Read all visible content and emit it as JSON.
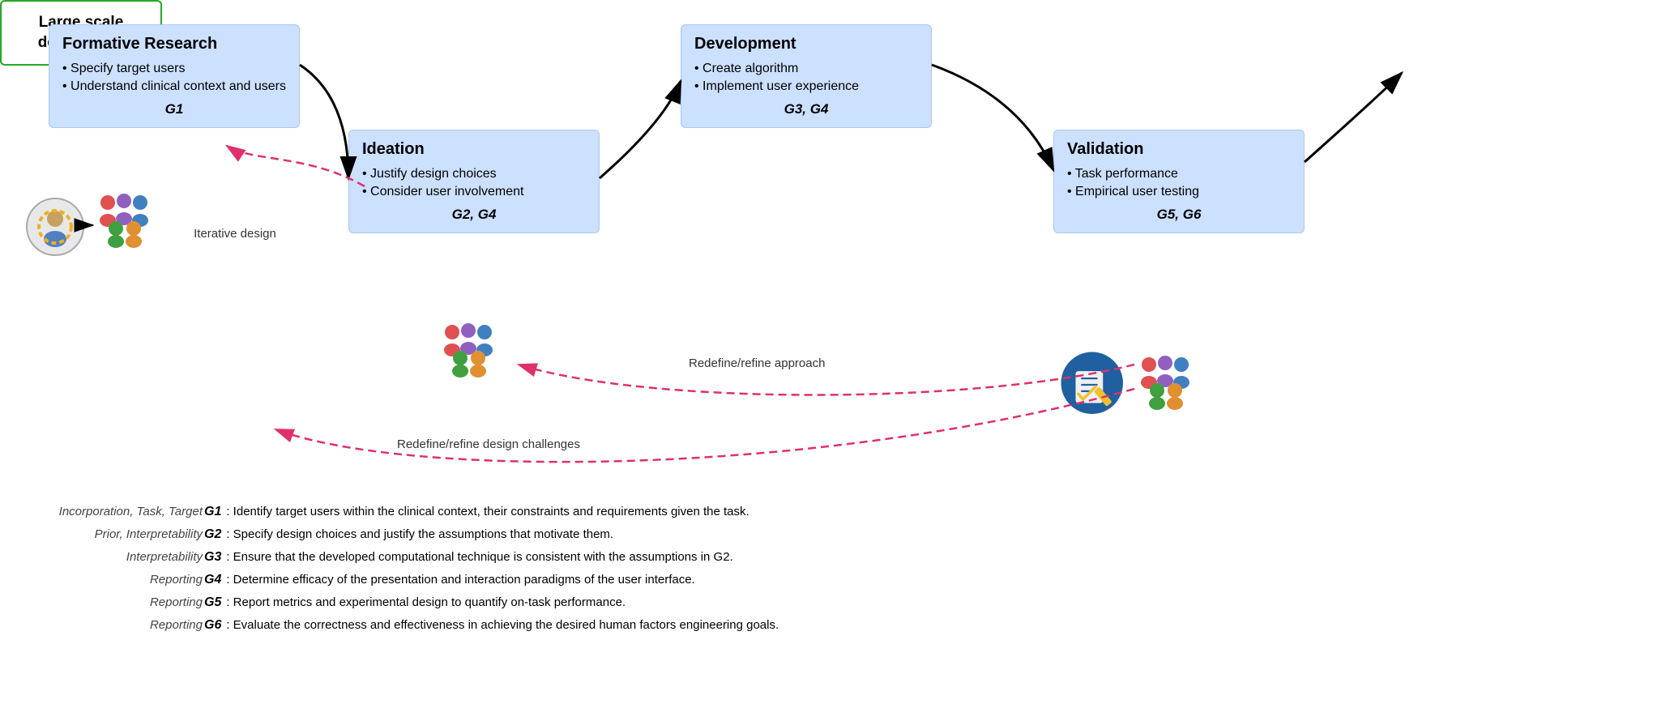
{
  "boxes": {
    "formative": {
      "title": "Formative Research",
      "bullets": [
        "Specify target users",
        "Understand clinical context and users"
      ],
      "goal": "G1"
    },
    "ideation": {
      "title": "Ideation",
      "bullets": [
        "Justify design choices",
        "Consider user involvement"
      ],
      "goal": "G2, G4"
    },
    "development": {
      "title": "Development",
      "bullets": [
        "Create algorithm",
        "Implement user experience"
      ],
      "goal": "G3, G4"
    },
    "validation": {
      "title": "Validation",
      "bullets": [
        "Task performance",
        "Empirical user testing"
      ],
      "goal": "G5, G6"
    },
    "deployment": {
      "title": "Large scale deployment"
    }
  },
  "labels": {
    "iterative": "Iterative design",
    "redefine_approach": "Redefine/refine approach",
    "redefine_design": "Redefine/refine design challenges"
  },
  "legend": [
    {
      "prefix": "Incorporation, Task, Target",
      "bold": "G1",
      "text": ": Identify target users within the clinical context, their constraints and requirements given the task."
    },
    {
      "prefix": "Prior, Interpretability",
      "bold": "G2",
      "text": ": Specify design choices and justify the assumptions that motivate them."
    },
    {
      "prefix": "Interpretability",
      "bold": "G3",
      "text": ": Ensure that the developed computational technique is consistent with the assumptions in G2."
    },
    {
      "prefix": "Reporting",
      "bold": "G4",
      "text": ": Determine efficacy of the presentation and interaction paradigms of the user interface."
    },
    {
      "prefix": "Reporting",
      "bold": "G5",
      "text": ": Report metrics and experimental design to quantify on-task performance."
    },
    {
      "prefix": "Reporting",
      "bold": "G6",
      "text": ": Evaluate the correctness and effectiveness in achieving the desired human factors engineering goals."
    }
  ]
}
